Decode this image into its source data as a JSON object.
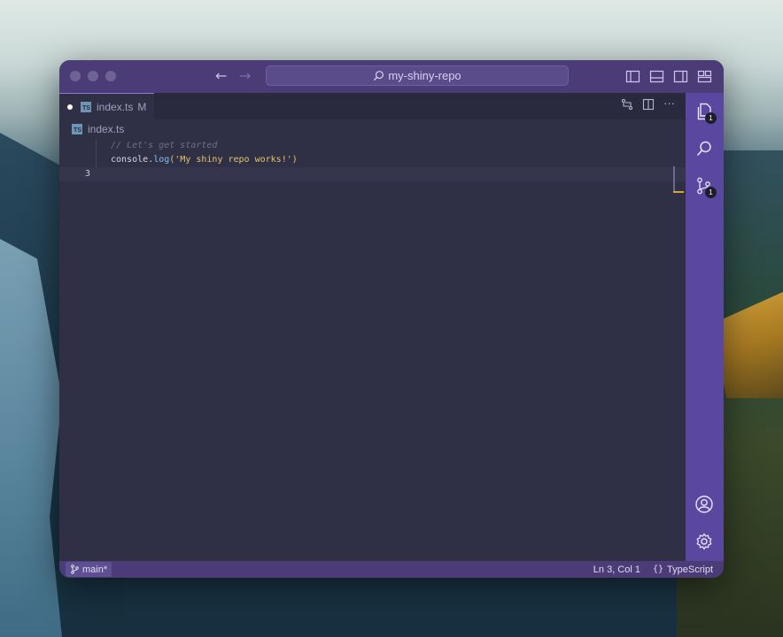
{
  "window": {
    "search_label": "my-shiny-repo"
  },
  "tabs": [
    {
      "file_icon": "TS",
      "label": "index.ts",
      "status": "M",
      "modified": true
    }
  ],
  "breadcrumb": {
    "file_icon": "TS",
    "label": "index.ts"
  },
  "editor": {
    "lines": [
      {
        "number": "",
        "comment": "// Let's get started"
      },
      {
        "number": "",
        "ident": "console",
        "dot": ".",
        "func": "log",
        "open": "(",
        "string": "'My shiny repo works!'",
        "close": ")"
      },
      {
        "number": "3",
        "text": ""
      }
    ]
  },
  "activity_bar": {
    "explorer_badge": "1",
    "source_control_badge": "1"
  },
  "status_bar": {
    "branch": "main*",
    "cursor": "Ln 3, Col 1",
    "language": "TypeScript"
  },
  "colors": {
    "accent": "#5a48a0",
    "titlebar": "#4b3c78",
    "editor_bg": "#2f2f45",
    "string": "#e6c46a",
    "function": "#7fc4e8"
  }
}
